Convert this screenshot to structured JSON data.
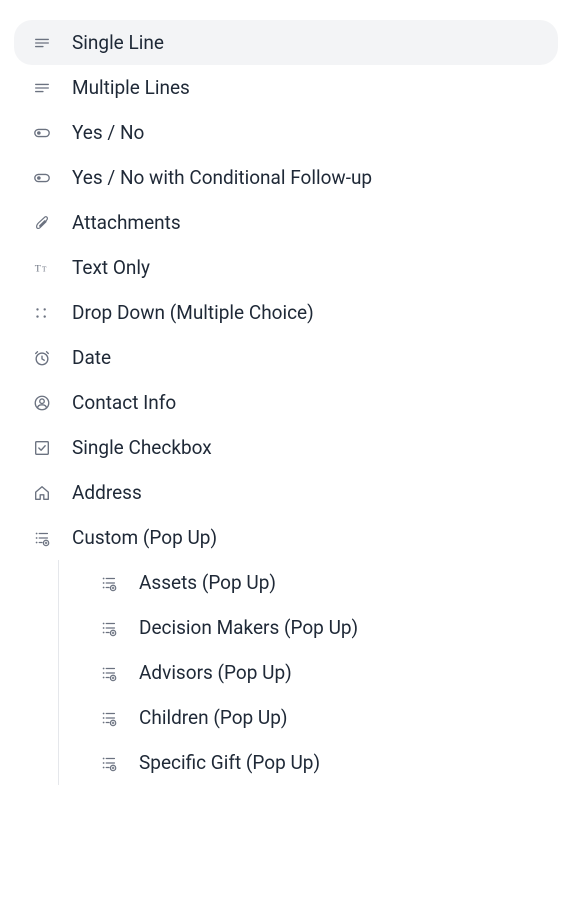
{
  "items": [
    {
      "label": "Single Line",
      "icon": "text-line",
      "selected": true
    },
    {
      "label": "Multiple Lines",
      "icon": "text-lines",
      "selected": false
    },
    {
      "label": "Yes / No",
      "icon": "toggle",
      "selected": false
    },
    {
      "label": "Yes / No with Conditional Follow-up",
      "icon": "toggle",
      "selected": false
    },
    {
      "label": "Attachments",
      "icon": "paperclip",
      "selected": false
    },
    {
      "label": "Text Only",
      "icon": "text-type",
      "selected": false
    },
    {
      "label": "Drop Down (Multiple Choice)",
      "icon": "grid-dots",
      "selected": false
    },
    {
      "label": "Date",
      "icon": "clock",
      "selected": false
    },
    {
      "label": "Contact Info",
      "icon": "user",
      "selected": false
    },
    {
      "label": "Single Checkbox",
      "icon": "checkbox",
      "selected": false
    },
    {
      "label": "Address",
      "icon": "home",
      "selected": false
    },
    {
      "label": "Custom (Pop Up)",
      "icon": "list-plus",
      "selected": false
    }
  ],
  "subitems": [
    {
      "label": "Assets (Pop Up)",
      "icon": "list-plus"
    },
    {
      "label": "Decision Makers (Pop Up)",
      "icon": "list-plus"
    },
    {
      "label": "Advisors (Pop Up)",
      "icon": "list-plus"
    },
    {
      "label": "Children (Pop Up)",
      "icon": "list-plus"
    },
    {
      "label": "Specific Gift (Pop Up)",
      "icon": "list-plus"
    }
  ]
}
